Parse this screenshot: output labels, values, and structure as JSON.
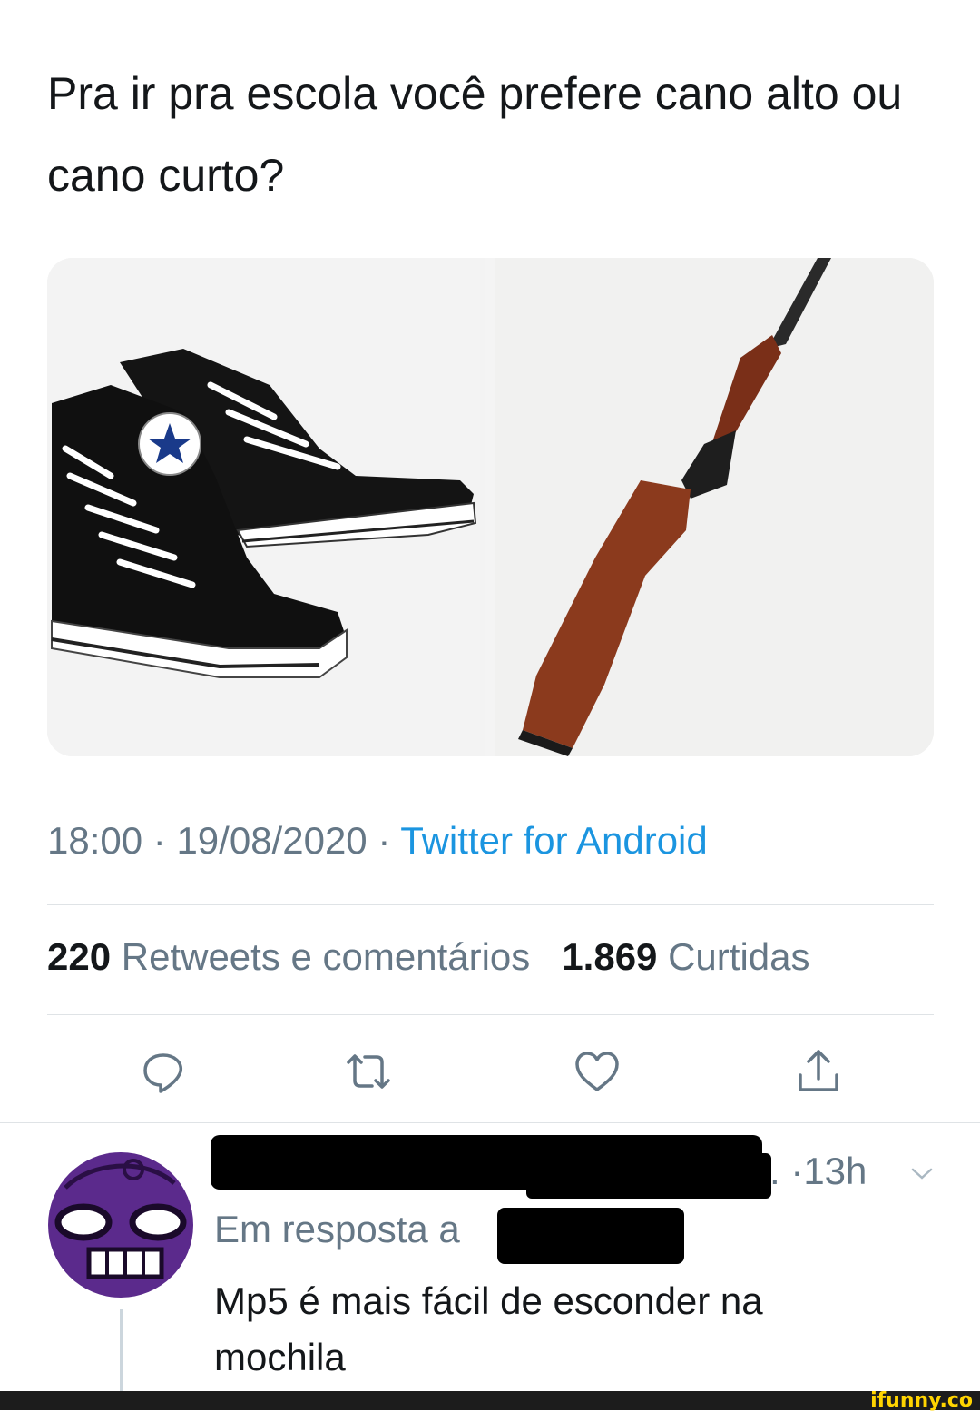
{
  "tweet": {
    "text": "Pra ir pra escola você prefere cano alto ou cano curto?",
    "time": "18:00",
    "separator": "·",
    "date": "19/08/2020",
    "source": "Twitter for Android"
  },
  "media": {
    "left_image": "converse-sneakers-image",
    "right_image": "shotgun-image"
  },
  "stats": {
    "retweets_count": "220",
    "retweets_label": "Retweets e comentários",
    "likes_count": "1.869",
    "likes_label": "Curtidas"
  },
  "actions": {
    "icons": [
      "reply-icon",
      "retweet-icon",
      "like-icon",
      "share-icon"
    ]
  },
  "reply": {
    "time_suffix": ". ·13h",
    "in_reply_to": "Em resposta a",
    "text": "Mp5 é mais fácil de esconder na mochila"
  },
  "watermark": "ifunny.co",
  "colors": {
    "link": "#1b95e0",
    "secondary_text": "#657786",
    "primary_text": "#14171a",
    "avatar_purple": "#5b2a8c"
  }
}
